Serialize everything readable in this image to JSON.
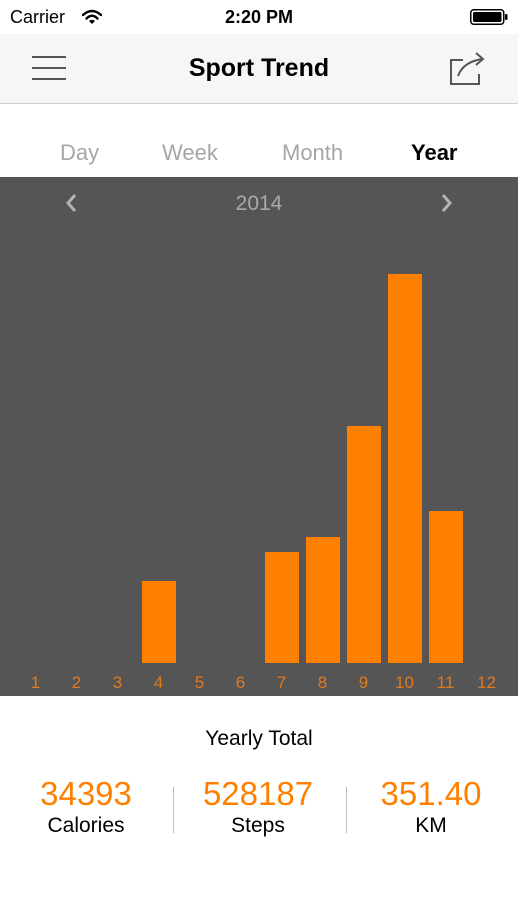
{
  "status_bar": {
    "carrier": "Carrier",
    "time": "2:20 PM"
  },
  "nav": {
    "title": "Sport Trend",
    "menu_icon": "hamburger-menu-icon",
    "share_icon": "share-icon"
  },
  "segments": [
    {
      "label": "Day",
      "active": false
    },
    {
      "label": "Week",
      "active": false
    },
    {
      "label": "Month",
      "active": false
    },
    {
      "label": "Year",
      "active": true
    }
  ],
  "chart": {
    "period": "2014",
    "prev_icon": "chevron-left-icon",
    "next_icon": "chevron-right-icon"
  },
  "chart_data": {
    "type": "bar",
    "categories": [
      "1",
      "2",
      "3",
      "4",
      "5",
      "6",
      "7",
      "8",
      "9",
      "10",
      "11",
      "12"
    ],
    "values": [
      0,
      0,
      0,
      21,
      0,
      0,
      28.5,
      32.5,
      61,
      100,
      39,
      0
    ],
    "ylim": [
      0,
      100
    ],
    "grid": false,
    "bar_color": "#ff8000",
    "background_color": "#555555",
    "label_color": "#e07a1f"
  },
  "summary": {
    "title": "Yearly Total",
    "stats": [
      {
        "value": "34393",
        "label": "Calories"
      },
      {
        "value": "528187",
        "label": "Steps"
      },
      {
        "value": "351.40",
        "label": "KM"
      }
    ]
  },
  "colors": {
    "accent": "#ff8000",
    "chart_bg": "#555555",
    "nav_bg": "#f6f6f6"
  }
}
